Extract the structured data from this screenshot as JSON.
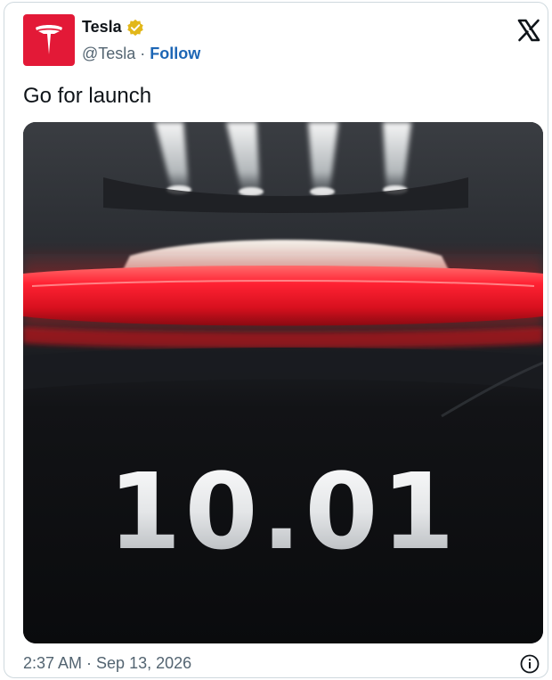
{
  "tweet": {
    "author": {
      "display_name": "Tesla",
      "handle": "@Tesla",
      "separator": " · ",
      "follow_label": "Follow",
      "verified_badge_icon": "verified-gold-badge-icon",
      "avatar_icon": "tesla-t-logo-icon"
    },
    "platform_icon": "x-logo-icon",
    "text": "Go for launch",
    "media": {
      "overlay_text": "10.01"
    },
    "timestamp": "2:37 AM · Sep 13, 2026",
    "info_icon": "info-icon"
  },
  "colors": {
    "brand_red": "#e31937",
    "follow_blue": "#1d66b5",
    "muted_text": "#536471",
    "verified_gold": "#e2b719"
  }
}
